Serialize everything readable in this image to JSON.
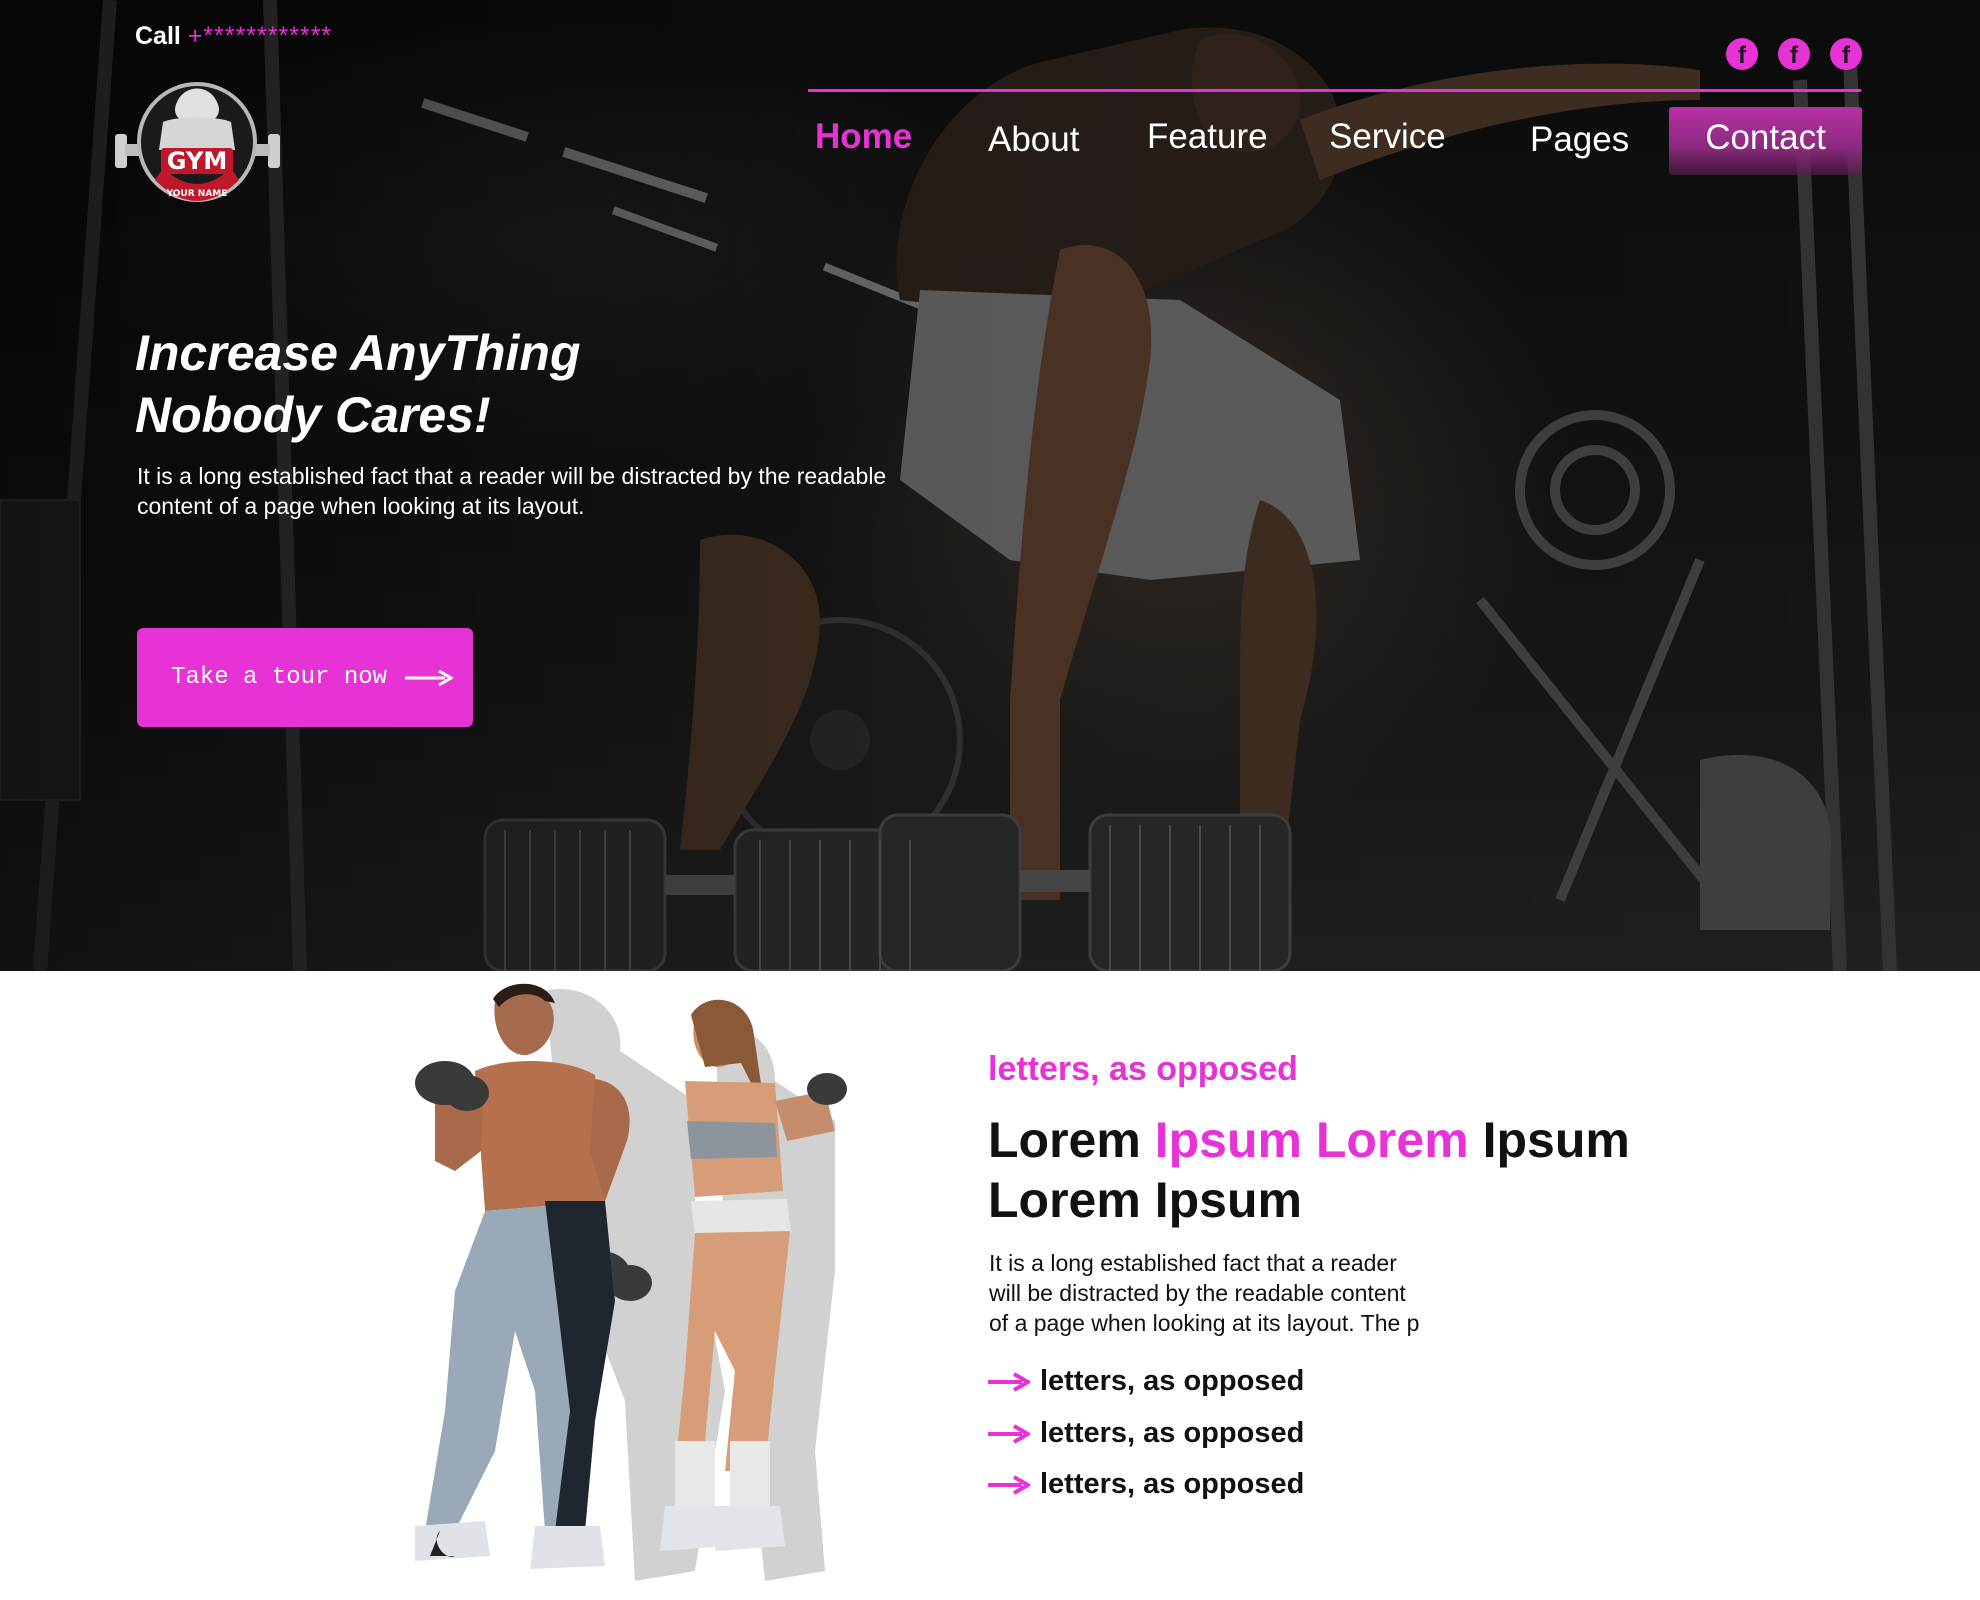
{
  "topbar": {
    "call_label": "Call",
    "phone": "+************"
  },
  "logo": {
    "wordmark": "GYM",
    "tagline": "YOUR NAME"
  },
  "social": [
    {
      "icon": "facebook-icon",
      "glyph": "f"
    },
    {
      "icon": "facebook-icon",
      "glyph": "f"
    },
    {
      "icon": "facebook-icon",
      "glyph": "f"
    }
  ],
  "nav": {
    "items": [
      {
        "label": "Home",
        "active": true
      },
      {
        "label": "About",
        "active": false
      },
      {
        "label": "Feature",
        "active": false
      },
      {
        "label": "Service",
        "active": false
      },
      {
        "label": "Pages",
        "active": false
      },
      {
        "label": "Contact",
        "active": false
      }
    ]
  },
  "hero": {
    "title_line1": "Increase AnyThing",
    "title_line2": "Nobody Cares!",
    "desc_line1": "It is a long established fact that a reader will be distracted by the readable",
    "desc_line2": "content of a page when looking at its layout.",
    "cta_label": "Take a tour now"
  },
  "about": {
    "kicker": "letters, as opposed",
    "heading": {
      "word1": "Lorem",
      "accent": "Ipsum Lorem",
      "word2": "Ipsum",
      "line2": "Lorem Ipsum"
    },
    "desc_line1": "It is a long established fact that a reader",
    "desc_line2": "will be distracted by the readable content",
    "desc_line3": "of a page when looking at its layout. The p",
    "features": [
      "letters, as opposed",
      "letters, as opposed",
      "letters, as opposed"
    ]
  },
  "colors": {
    "accent": "#e733d6",
    "hero_bg": "#141414",
    "text_dark": "#111111",
    "text_light": "#ffffff"
  }
}
